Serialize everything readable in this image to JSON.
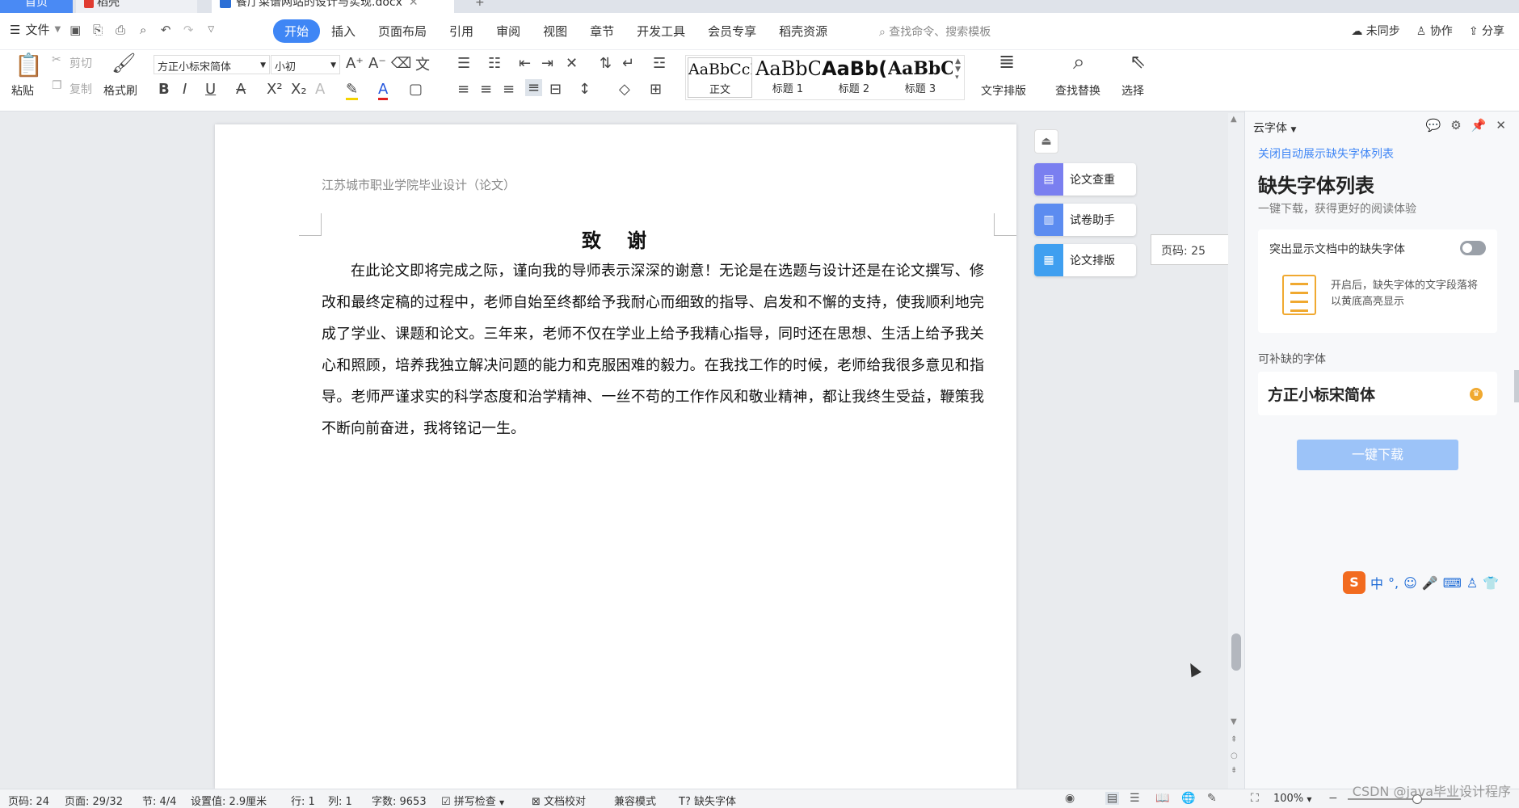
{
  "tabs": {
    "home": "首页",
    "shell": "稻壳",
    "doc": "餐厅菜谱网站的设计与实现.docx",
    "add": "+"
  },
  "menubar": {
    "file": "文件",
    "tabs": [
      "开始",
      "插入",
      "页面布局",
      "引用",
      "审阅",
      "视图",
      "章节",
      "开发工具",
      "会员专享",
      "稻壳资源"
    ],
    "active_tab": "开始",
    "search_placeholder": "查找命令、搜索模板",
    "unsync": "未同步",
    "collab": "协作",
    "share": "分享"
  },
  "ribbon": {
    "paste": "粘贴",
    "cut": "剪切",
    "copy": "复制",
    "format_painter": "格式刷",
    "font_name": "方正小标宋简体",
    "font_size": "小初",
    "styles": [
      {
        "preview": "AaBbCcI",
        "label": "正文"
      },
      {
        "preview": "AaBbC",
        "label": "标题 1"
      },
      {
        "preview": "AaBb(",
        "label": "标题 2"
      },
      {
        "preview": "AaBbC",
        "label": "标题 3"
      }
    ],
    "text_layout": "文字排版",
    "find_replace": "查找替换",
    "select": "选择"
  },
  "document": {
    "header": "江苏城市职业学院毕业设计（论文）",
    "title": "致　谢",
    "body": "在此论文即将完成之际，谨向我的导师表示深深的谢意！无论是在选题与设计还是在论文撰写、修改和最终定稿的过程中，老师自始至终都给予我耐心而细致的指导、启发和不懈的支持，使我顺利地完成了学业、课题和论文。三年来，老师不仅在学业上给予我精心指导，同时还在思想、生活上给予我关心和照顾，培养我独立解决问题的能力和克服困难的毅力。在我找工作的时候，老师给我很多意见和指导。老师严谨求实的科学态度和治学精神、一丝不苟的工作作风和敬业精神，都让我终生受益，鞭策我不断向前奋进，我将铭记一生。"
  },
  "side_tools": {
    "check": "论文查重",
    "exam": "试卷助手",
    "layout": "论文排版",
    "page_indicator": "页码: 25"
  },
  "panel": {
    "header": "云字体",
    "link": "关闭自动展示缺失字体列表",
    "title": "缺失字体列表",
    "subtitle": "一键下载，获得更好的阅读体验",
    "highlight_label": "突出显示文档中的缺失字体",
    "highlight_desc": "开启后，缺失字体的文字段落将以黄底高亮显示",
    "section_label": "可补缺的字体",
    "font_item": "方正小标宋简体",
    "download_btn": "一键下载"
  },
  "ime": {
    "lang": "中"
  },
  "statusbar": {
    "page_num": "页码: 24",
    "page_count": "页面: 29/32",
    "section": "节: 4/4",
    "setting": "设置值: 2.9厘米",
    "row": "行: 1",
    "col": "列: 1",
    "word_count": "字数: 9653",
    "spellcheck": "拼写检查",
    "doc_proof": "文档校对",
    "compat": "兼容模式",
    "missing_font": "缺失字体",
    "zoom": "100%"
  },
  "watermark": "CSDN @java毕业设计程序"
}
